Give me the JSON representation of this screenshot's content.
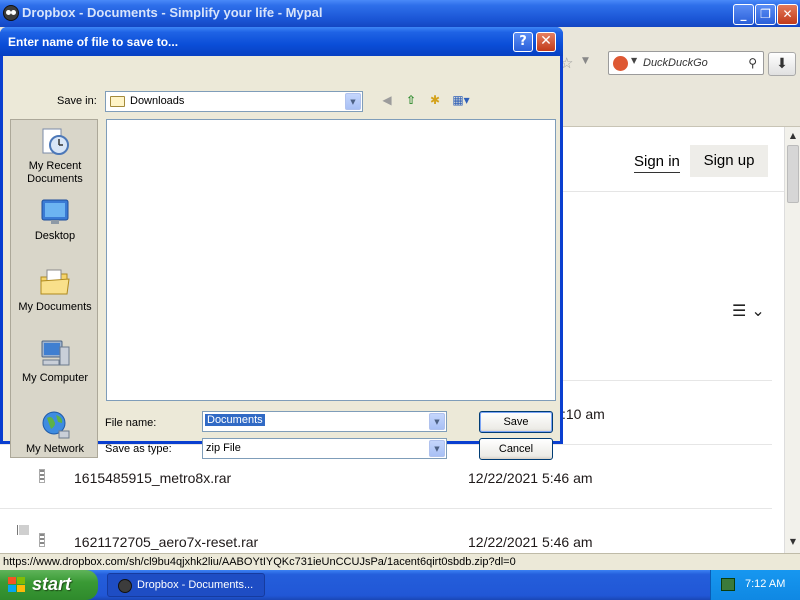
{
  "browser": {
    "title": "Dropbox - Documents - Simplify your life - Mypal",
    "search_placeholder": "DuckDuckGo",
    "status_url": "https://www.dropbox.com/sh/cl9bu4qjxhk2liu/AABOYtIYQKc731ieUnCCUJsPa/1acent6qirt0sbdb.zip?dl=0"
  },
  "page": {
    "sign_in": "Sign in",
    "sign_up": "Sign up",
    "menu_glyph": "☰ ⌄",
    "files": [
      {
        "name": "",
        "date": ":10 am"
      },
      {
        "name": "1615485915_metro8x.rar",
        "date": "12/22/2021 5:46 am"
      },
      {
        "name": "1621172705_aero7x-reset.rar",
        "date": "12/22/2021 5:46 am"
      }
    ]
  },
  "dialog": {
    "title": "Enter name of file to save to...",
    "help": "?",
    "close": "✕",
    "save_in_label": "Save in:",
    "save_in_value": "Downloads",
    "places": [
      "My Recent Documents",
      "Desktop",
      "My Documents",
      "My Computer",
      "My Network"
    ],
    "file_name_label": "File name:",
    "file_name_value": "Documents",
    "save_as_type_label": "Save as type:",
    "save_as_type_value": "zip File",
    "save_button": "Save",
    "cancel_button": "Cancel"
  },
  "taskbar": {
    "start": "start",
    "task_label": "Dropbox - Documents...",
    "clock": "7:12 AM"
  },
  "colors": {
    "xp_blue": "#0A3FD0",
    "start_green": "#3A9A35",
    "dialog_face": "#ECE9D8",
    "selection": "#316AC5"
  }
}
